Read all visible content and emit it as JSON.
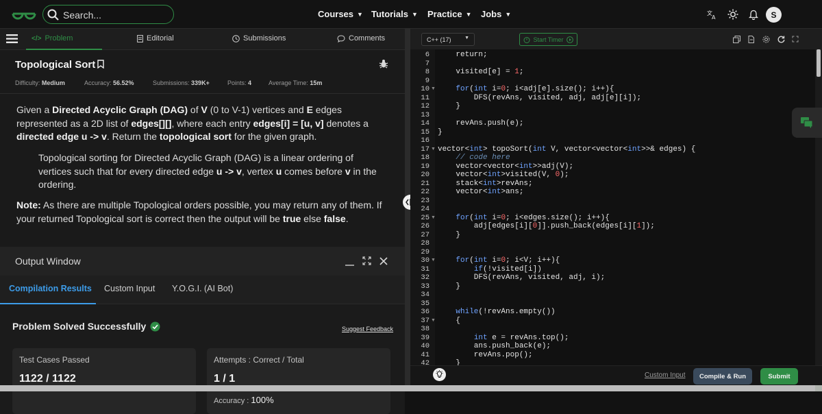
{
  "nav": {
    "search_placeholder": "Search...",
    "links": [
      "Courses",
      "Tutorials",
      "Practice",
      "Jobs"
    ],
    "avatar_letter": "S",
    "brand_color": "#2f8d46"
  },
  "problem_tabs": [
    "Problem",
    "Editorial",
    "Submissions",
    "Comments"
  ],
  "problem": {
    "title": "Topological Sort",
    "difficulty_label": "Difficulty:",
    "difficulty": "Medium",
    "accuracy_label": "Accuracy:",
    "accuracy": "56.52%",
    "submissions_label": "Submissions:",
    "submissions": "339K+",
    "points_label": "Points:",
    "points": "4",
    "avg_time_label": "Average Time:",
    "avg_time": "15m",
    "p1": [
      {
        "t": "Given a ",
        "b": false
      },
      {
        "t": "Directed Acyclic Graph (DAG)",
        "b": true
      },
      {
        "t": " of ",
        "b": false
      },
      {
        "t": "V",
        "b": true
      },
      {
        "t": " (0 to V-1) vertices and ",
        "b": false
      },
      {
        "t": "E",
        "b": true
      },
      {
        "t": " edges represented as a 2D list of ",
        "b": false
      },
      {
        "t": "edges[][]",
        "b": true
      },
      {
        "t": ", where each entry ",
        "b": false
      },
      {
        "t": "edges[i] = [u, v]",
        "b": true
      },
      {
        "t": " denotes a ",
        "b": false
      },
      {
        "t": "directed edge u -> v",
        "b": true
      },
      {
        "t": ". Return the ",
        "b": false
      },
      {
        "t": "topological sort",
        "b": true
      },
      {
        "t": " for the given graph.",
        "b": false
      }
    ],
    "p2": [
      {
        "t": "Topological sorting for Directed Acyclic Graph (DAG) is a linear ordering of vertices such that for every directed edge ",
        "b": false
      },
      {
        "t": "u -> v",
        "b": true
      },
      {
        "t": ", vertex ",
        "b": false
      },
      {
        "t": "u",
        "b": true
      },
      {
        "t": " comes before ",
        "b": false
      },
      {
        "t": "v",
        "b": true
      },
      {
        "t": " in the ordering.",
        "b": false
      }
    ],
    "p3": [
      {
        "t": "Note:",
        "b": true
      },
      {
        "t": " As there are multiple Topological orders possible, you may return any of them. If your returned Topological sort is correct then the output will be ",
        "b": false
      },
      {
        "t": "true",
        "b": true
      },
      {
        "t": " else ",
        "b": false
      },
      {
        "t": "false",
        "b": true
      },
      {
        "t": ".",
        "b": false
      }
    ]
  },
  "output": {
    "title": "Output Window",
    "tabs": [
      "Compilation Results",
      "Custom Input",
      "Y.O.G.I. (AI Bot)"
    ],
    "status": "Problem Solved Successfully",
    "feedback": "Suggest Feedback",
    "cards": {
      "tests_label": "Test Cases Passed",
      "tests_value": "1122 / 1122",
      "attempts_label": "Attempts : Correct / Total",
      "attempts_value": "1 / 1",
      "accuracy_label": "Accuracy :",
      "accuracy_value": "100%"
    }
  },
  "editor": {
    "language": "C++ (17)",
    "timer": "Start Timer",
    "first_line": 6,
    "fold_lines": [
      10,
      17,
      25,
      30,
      37
    ],
    "code": [
      [
        [
          "",
          "    return;"
        ]
      ],
      [
        [
          "",
          ""
        ]
      ],
      [
        [
          "",
          "    visited[e] = "
        ],
        [
          "num",
          "1"
        ],
        [
          "",
          ";"
        ]
      ],
      [
        [
          "",
          ""
        ]
      ],
      [
        [
          "",
          "    "
        ],
        [
          "kw",
          "for"
        ],
        [
          "",
          "("
        ],
        [
          "kw",
          "int"
        ],
        [
          "",
          " i="
        ],
        [
          "num",
          "0"
        ],
        [
          "",
          "; i<adj[e].size(); i++){"
        ]
      ],
      [
        [
          "",
          "        DFS(revAns, visited, adj, adj[e][i]);"
        ]
      ],
      [
        [
          "",
          "    }"
        ]
      ],
      [
        [
          "",
          ""
        ]
      ],
      [
        [
          "",
          "    revAns.push(e);"
        ]
      ],
      [
        [
          "",
          "}"
        ]
      ],
      [
        [
          "",
          ""
        ]
      ],
      [
        [
          "",
          "vector<"
        ],
        [
          "kw",
          "int"
        ],
        [
          "",
          "> topoSort("
        ],
        [
          "kw",
          "int"
        ],
        [
          "",
          " V, vector<vector<"
        ],
        [
          "kw",
          "int"
        ],
        [
          "",
          ">>& edges) {"
        ]
      ],
      [
        [
          "cm",
          "    // code here"
        ]
      ],
      [
        [
          "",
          "    vector<vector<"
        ],
        [
          "kw",
          "int"
        ],
        [
          "",
          ">>adj(V);"
        ]
      ],
      [
        [
          "",
          "    vector<"
        ],
        [
          "kw",
          "int"
        ],
        [
          "",
          ">visited(V, "
        ],
        [
          "num",
          "0"
        ],
        [
          "",
          ");"
        ]
      ],
      [
        [
          "",
          "    stack<"
        ],
        [
          "kw",
          "int"
        ],
        [
          "",
          ">revAns;"
        ]
      ],
      [
        [
          "",
          "    vector<"
        ],
        [
          "kw",
          "int"
        ],
        [
          "",
          ">ans;"
        ]
      ],
      [
        [
          "",
          ""
        ]
      ],
      [
        [
          "",
          ""
        ]
      ],
      [
        [
          "",
          "    "
        ],
        [
          "kw",
          "for"
        ],
        [
          "",
          "("
        ],
        [
          "kw",
          "int"
        ],
        [
          "",
          " i="
        ],
        [
          "num",
          "0"
        ],
        [
          "",
          "; i<edges.size(); i++){"
        ]
      ],
      [
        [
          "",
          "        adj[edges[i]["
        ],
        [
          "num",
          "0"
        ],
        [
          "",
          "]].push_back(edges[i]["
        ],
        [
          "num",
          "1"
        ],
        [
          "",
          "]);"
        ]
      ],
      [
        [
          "",
          "    }"
        ]
      ],
      [
        [
          "",
          ""
        ]
      ],
      [
        [
          "",
          ""
        ]
      ],
      [
        [
          "",
          "    "
        ],
        [
          "kw",
          "for"
        ],
        [
          "",
          "("
        ],
        [
          "kw",
          "int"
        ],
        [
          "",
          " i="
        ],
        [
          "num",
          "0"
        ],
        [
          "",
          "; i<V; i++){"
        ]
      ],
      [
        [
          "",
          "        "
        ],
        [
          "kw",
          "if"
        ],
        [
          "",
          "(!visited[i])"
        ]
      ],
      [
        [
          "",
          "        DFS(revAns, visited, adj, i);"
        ]
      ],
      [
        [
          "",
          "    }"
        ]
      ],
      [
        [
          "",
          ""
        ]
      ],
      [
        [
          "",
          ""
        ]
      ],
      [
        [
          "",
          "    "
        ],
        [
          "kw",
          "while"
        ],
        [
          "",
          "(!revAns.empty())"
        ]
      ],
      [
        [
          "",
          "    {"
        ]
      ],
      [
        [
          "",
          ""
        ]
      ],
      [
        [
          "",
          "        "
        ],
        [
          "kw",
          "int"
        ],
        [
          "",
          " e = revAns.top();"
        ]
      ],
      [
        [
          "",
          "        ans.push_back(e);"
        ]
      ],
      [
        [
          "",
          "        revAns.pop();"
        ]
      ],
      [
        [
          "",
          "    }"
        ]
      ]
    ],
    "footer": {
      "custom_input": "Custom Input",
      "compile": "Compile & Run",
      "submit": "Submit"
    }
  }
}
